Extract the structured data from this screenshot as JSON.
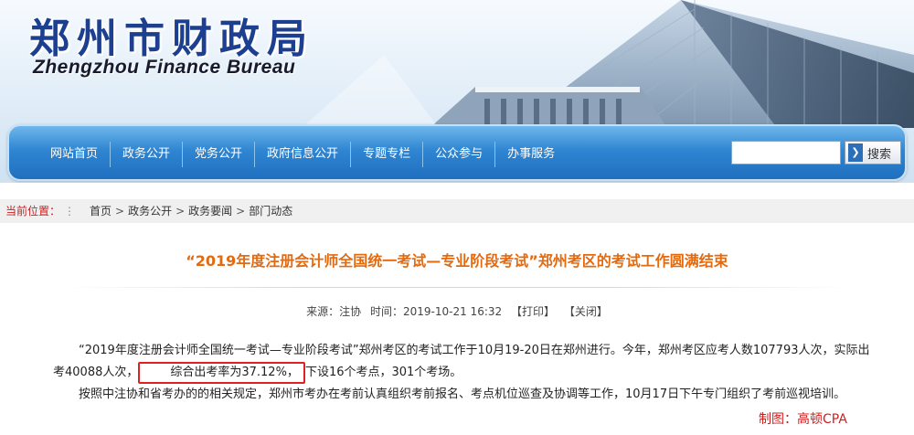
{
  "site": {
    "logo_cn": "郑州市财政局",
    "logo_en": "Zhengzhou Finance Bureau"
  },
  "nav": {
    "items": [
      "网站首页",
      "政务公开",
      "党务公开",
      "政府信息公开",
      "专题专栏",
      "公众参与",
      "办事服务"
    ],
    "search_value": "",
    "search_label": "搜索"
  },
  "breadcrumb": {
    "label": "当前位置：",
    "items": [
      "首页",
      "政务公开",
      "政务要闻",
      "部门动态"
    ]
  },
  "article": {
    "title": "“2019年度注册会计师全国统一考试—专业阶段考试”郑州考区的考试工作圆满结束",
    "source": "来源：注协",
    "time": "时间：2019-10-21 16:32",
    "print": "【打印】",
    "close": "【关闭】",
    "para1_a": "“2019年度注册会计师全国统一考试—专业阶段考试”郑州考区的考试工作于10月19-20日在郑州进行。今年，郑州考区应考人数107793人次，实际出考40088人次，",
    "para1_highlight": "综合出考率为37.12%，",
    "para1_b": "下设16个考点，301个考场。",
    "para2": "按照中注协和省考办的的相关规定，郑州市考办在考前认真组织考前报名、考点机位巡查及协调等工作，10月17日下午专门组织了考前巡视培训。"
  },
  "credit": "制图：高顿CPA",
  "colors": {
    "title": "#e26a11",
    "nav": "#2f86d2",
    "highlight_border": "#dd2222",
    "crumb_label": "#d01c1c"
  }
}
